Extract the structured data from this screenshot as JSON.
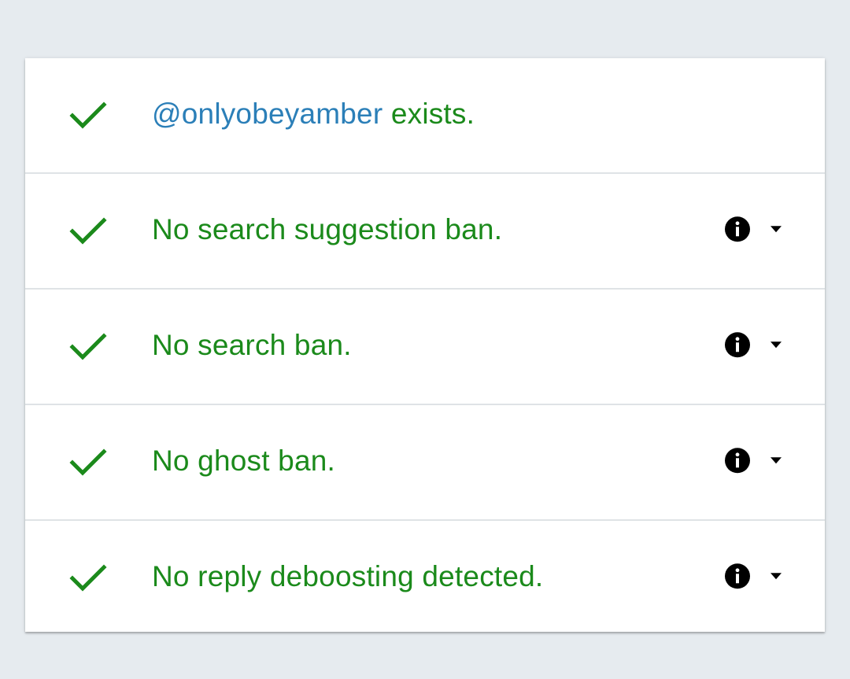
{
  "colors": {
    "background": "#e6ebef",
    "card": "#ffffff",
    "success_green": "#1b8a1b",
    "handle_blue": "#2b7fb8",
    "icon_black": "#000000",
    "divider": "#dfe3e6"
  },
  "rows": [
    {
      "icon": "check-icon",
      "handle": "@onlyobeyamber",
      "text": " exists."
    },
    {
      "icon": "check-icon",
      "text": "No search suggestion ban.",
      "info_icon": "info-icon",
      "toggle_icon": "caret-down-icon"
    },
    {
      "icon": "check-icon",
      "text": "No search ban.",
      "info_icon": "info-icon",
      "toggle_icon": "caret-down-icon"
    },
    {
      "icon": "check-icon",
      "text": "No ghost ban.",
      "info_icon": "info-icon",
      "toggle_icon": "caret-down-icon"
    },
    {
      "icon": "check-icon",
      "text": "No reply deboosting detected.",
      "info_icon": "info-icon",
      "toggle_icon": "caret-down-icon"
    }
  ]
}
